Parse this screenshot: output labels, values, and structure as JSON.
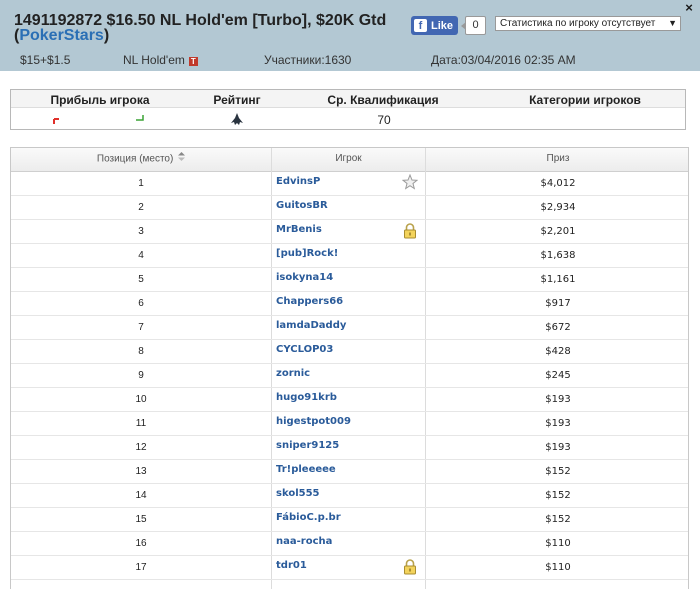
{
  "header": {
    "close_label": "×",
    "title_line1": "1491192872 $16.50 NL Hold'em [Turbo], $20K Gtd",
    "title_open": "(",
    "site_name": "PokerStars",
    "title_close": ")",
    "fb_like_label": "Like",
    "fb_like_count": "0",
    "stats_select_value": "Статистика по игроку отсутствует",
    "buyin": "$15+$1.5",
    "game": "NL Hold'em",
    "turbo_badge": "T",
    "participants": "Участники:1630",
    "date": "Дата:03/04/2016 02:35 AM"
  },
  "stats": {
    "headers": [
      "Прибыль игрока",
      "Рейтинг",
      "Ср. Квалификация",
      "Категории игроков"
    ],
    "avg_qualification": "70",
    "colors": {
      "profit_red": "#e0302a",
      "profit_green": "#3aa335"
    }
  },
  "table": {
    "columns": [
      "Позиция (место)",
      "Игрок",
      "Приз"
    ],
    "sort_icon": "sort-arrows-icon",
    "rows": [
      {
        "pos": "1",
        "player": "EdvinsP",
        "prize": "$4,012",
        "icon": "star-icon"
      },
      {
        "pos": "2",
        "player": "GuitosBR",
        "prize": "$2,934",
        "icon": ""
      },
      {
        "pos": "3",
        "player": "MrBenis",
        "prize": "$2,201",
        "icon": "lock-icon"
      },
      {
        "pos": "4",
        "player": "[pub]Rock!",
        "prize": "$1,638",
        "icon": ""
      },
      {
        "pos": "5",
        "player": "isokyna14",
        "prize": "$1,161",
        "icon": ""
      },
      {
        "pos": "6",
        "player": "Chappers66",
        "prize": "$917",
        "icon": ""
      },
      {
        "pos": "7",
        "player": "lamdaDaddy",
        "prize": "$672",
        "icon": ""
      },
      {
        "pos": "8",
        "player": "CYCLOP03",
        "prize": "$428",
        "icon": ""
      },
      {
        "pos": "9",
        "player": "zornic",
        "prize": "$245",
        "icon": ""
      },
      {
        "pos": "10",
        "player": "hugo91krb",
        "prize": "$193",
        "icon": ""
      },
      {
        "pos": "11",
        "player": "higestpot009",
        "prize": "$193",
        "icon": ""
      },
      {
        "pos": "12",
        "player": "sniper9125",
        "prize": "$193",
        "icon": ""
      },
      {
        "pos": "13",
        "player": "Tr!pleeeee",
        "prize": "$152",
        "icon": ""
      },
      {
        "pos": "14",
        "player": "skol555",
        "prize": "$152",
        "icon": ""
      },
      {
        "pos": "15",
        "player": "FábioC.p.br",
        "prize": "$152",
        "icon": ""
      },
      {
        "pos": "16",
        "player": "naa-rocha",
        "prize": "$110",
        "icon": ""
      },
      {
        "pos": "17",
        "player": "tdr01",
        "prize": "$110",
        "icon": "lock-icon"
      }
    ]
  }
}
